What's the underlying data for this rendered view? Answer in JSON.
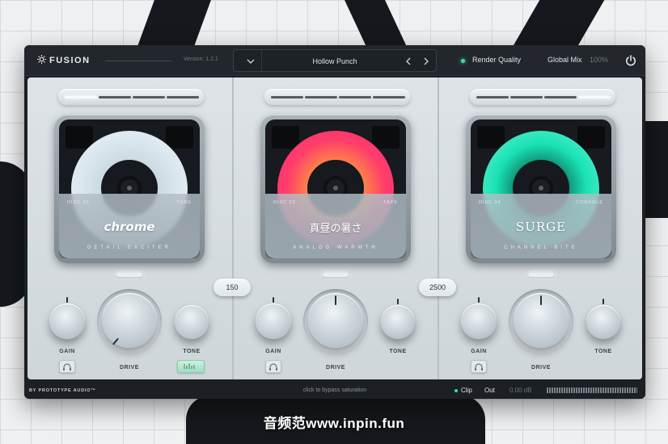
{
  "header": {
    "app_name": "FUSION",
    "version": "Version: 1.2.1",
    "preset_name": "Hollow Punch",
    "render_quality_label": "Render Quality",
    "global_mix_label": "Global Mix",
    "global_mix_value": "100%"
  },
  "bands": [
    {
      "disc_left": "DISC 01",
      "disc_right": "TUBE",
      "disc_name": "chrome",
      "disc_sub": "DETAIL EXCITER",
      "disc_color": "#d6e4ec",
      "gain_label": "GAIN",
      "drive_label": "DRIVE",
      "tone_label": "TONE",
      "meter_on": [
        1,
        0,
        0,
        0
      ]
    },
    {
      "disc_left": "DISC 02",
      "disc_right": "TAPE",
      "disc_name": "真昼の暑さ",
      "disc_sub": "ANALOG WARMTH",
      "disc_color": "#ff3d6b",
      "gain_label": "GAIN",
      "drive_label": "DRIVE",
      "tone_label": "TONE",
      "meter_on": [
        0,
        0,
        0,
        0
      ]
    },
    {
      "disc_left": "DISC 04",
      "disc_right": "CONSOLE",
      "disc_name": "SURGE",
      "disc_sub": "CHANNEL BITE",
      "disc_color": "#19e2b4",
      "gain_label": "GAIN",
      "drive_label": "DRIVE",
      "tone_label": "TONE",
      "meter_on": [
        0,
        0,
        0,
        1
      ]
    }
  ],
  "crossovers": [
    "150",
    "2500"
  ],
  "footer": {
    "brand": "BY PROTOTYPE AUDIO™",
    "bypass_hint": "click to bypass saturation",
    "clip_label": "Clip",
    "out_label": "Out",
    "out_value": "0.00 dB"
  },
  "watermark": "音频范www.inpin.fun",
  "icons": {
    "logo": "sun-gear-icon",
    "dropdown": "chevron-down-icon",
    "prev": "chevron-left-icon",
    "next": "chevron-right-icon",
    "power": "power-icon",
    "headphones": "headphones-icon",
    "waveform": "waveform-icon"
  }
}
